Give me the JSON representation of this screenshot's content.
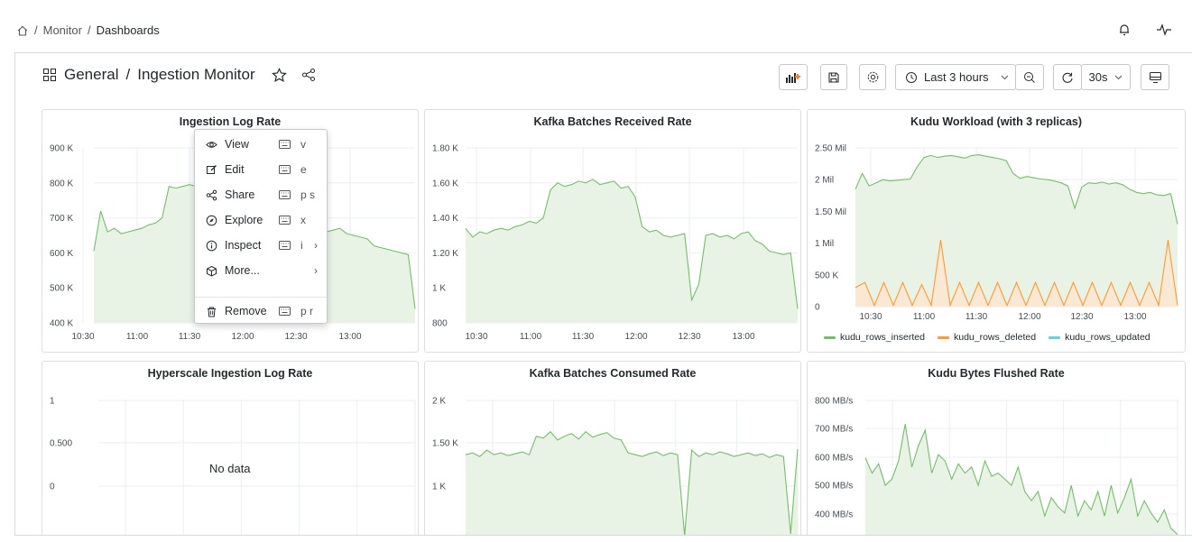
{
  "breadcrumb": {
    "items": [
      "Monitor",
      "Dashboards"
    ],
    "separator": "/"
  },
  "dashboard": {
    "folder": "General",
    "separator": "/",
    "title": "Ingestion Monitor"
  },
  "toolbar": {
    "time_range": "Last 3 hours",
    "refresh_interval": "30s"
  },
  "context_menu": {
    "items": [
      {
        "label": "View",
        "icon": "eye-icon",
        "shortcut": "v"
      },
      {
        "label": "Edit",
        "icon": "edit-icon",
        "shortcut": "e"
      },
      {
        "label": "Share",
        "icon": "share-icon",
        "shortcut": "p s"
      },
      {
        "label": "Explore",
        "icon": "compass-icon",
        "shortcut": "x"
      },
      {
        "label": "Inspect",
        "icon": "info-icon",
        "shortcut": "i",
        "submenu": true
      },
      {
        "label": "More...",
        "icon": "cube-icon",
        "submenu": true
      },
      {
        "label": "Remove",
        "icon": "trash-icon",
        "shortcut": "p r"
      }
    ]
  },
  "colors": {
    "green": "#73bf69",
    "green_fill": "#e8f3e6",
    "orange": "#ff9830",
    "orange_fill": "#fde5cf",
    "cyan": "#5ed7d6"
  },
  "panels": [
    {
      "title": "Ingestion Log Rate"
    },
    {
      "title": "Kafka Batches Received Rate"
    },
    {
      "title": "Kudu Workload (with 3 replicas)"
    },
    {
      "title": "Hyperscale Ingestion Log Rate",
      "no_data": "No data"
    },
    {
      "title": "Kafka Batches Consumed Rate"
    },
    {
      "title": "Kudu Bytes Flushed Rate"
    }
  ],
  "chart_data": [
    {
      "type": "area",
      "title": "Ingestion Log Rate",
      "y_ticks": [
        "900 K",
        "800 K",
        "700 K",
        "600 K",
        "500 K",
        "400 K"
      ],
      "x_ticks": [
        "10:30",
        "11:00",
        "11:30",
        "12:00",
        "12:30",
        "13:00"
      ],
      "ylim": [
        400000,
        900000
      ],
      "x_range": [
        "10:18",
        "13:18"
      ],
      "series": [
        {
          "values": [
            605000,
            720000,
            660000,
            670000,
            655000,
            660000,
            665000,
            670000,
            680000,
            685000,
            700000,
            790000,
            785000,
            790000,
            795000,
            790000,
            795000,
            790000,
            790000,
            785000,
            790000,
            780000,
            770000,
            760000,
            750000,
            740000,
            700000,
            690000,
            680000,
            675000,
            670000,
            660000,
            655000,
            650000,
            660000,
            665000,
            670000,
            655000,
            650000,
            645000,
            640000,
            620000,
            615000,
            610000,
            605000,
            600000,
            595000,
            440000
          ]
        }
      ]
    },
    {
      "type": "area",
      "title": "Kafka Batches Received Rate",
      "y_ticks": [
        "1.80 K",
        "1.60 K",
        "1.40 K",
        "1.20 K",
        "1 K",
        "800"
      ],
      "x_ticks": [
        "10:30",
        "11:00",
        "11:30",
        "12:00",
        "12:30",
        "13:00"
      ],
      "ylim": [
        800,
        1800
      ],
      "x_range": [
        "10:18",
        "13:18"
      ],
      "series": [
        {
          "values": [
            1340,
            1290,
            1320,
            1310,
            1330,
            1340,
            1330,
            1350,
            1360,
            1380,
            1370,
            1400,
            1560,
            1600,
            1580,
            1590,
            1610,
            1600,
            1620,
            1590,
            1600,
            1610,
            1570,
            1580,
            1520,
            1350,
            1320,
            1330,
            1300,
            1290,
            1300,
            1310,
            930,
            1020,
            1300,
            1310,
            1290,
            1300,
            1280,
            1310,
            1320,
            1270,
            1250,
            1210,
            1200,
            1190,
            1200,
            880
          ]
        }
      ]
    },
    {
      "type": "area",
      "title": "Kudu Workload (with 3 replicas)",
      "y_ticks": [
        "2.50 Mil",
        "2 Mil",
        "1.50 Mil",
        "1 Mil",
        "500 K",
        "0"
      ],
      "x_ticks": [
        "10:30",
        "11:00",
        "11:30",
        "12:00",
        "12:30",
        "13:00"
      ],
      "ylim": [
        0,
        2500000
      ],
      "x_range": [
        "10:22",
        "13:22"
      ],
      "legend": "bottom",
      "series": [
        {
          "name": "kudu_rows_inserted",
          "color": "#73bf69",
          "values": [
            1850000,
            2100000,
            1900000,
            1950000,
            2000000,
            1980000,
            1990000,
            2000000,
            2010000,
            2200000,
            2350000,
            2380000,
            2350000,
            2370000,
            2380000,
            2360000,
            2340000,
            2380000,
            2390000,
            2370000,
            2350000,
            2330000,
            2300000,
            2100000,
            2020000,
            2050000,
            2030000,
            2010000,
            2000000,
            1980000,
            1950000,
            1900000,
            1550000,
            1880000,
            1950000,
            1940000,
            1960000,
            1930000,
            1950000,
            1920000,
            1850000,
            1800000,
            1780000,
            1800000,
            1760000,
            1750000,
            1780000,
            1300000
          ]
        },
        {
          "name": "kudu_rows_deleted",
          "color": "#ff9830",
          "values": [
            300000,
            380000,
            20000,
            380000,
            20000,
            380000,
            20000,
            350000,
            20000,
            1050000,
            20000,
            380000,
            20000,
            380000,
            20000,
            380000,
            20000,
            380000,
            20000,
            380000,
            20000,
            380000,
            20000,
            380000,
            20000,
            380000,
            20000,
            380000,
            20000,
            380000,
            20000,
            380000,
            20000,
            1050000,
            20000
          ]
        },
        {
          "name": "kudu_rows_updated",
          "color": "#5ed7d6",
          "values": [
            0,
            0,
            0,
            0,
            0,
            0
          ]
        }
      ]
    },
    {
      "type": "line",
      "title": "Hyperscale Ingestion Log Rate",
      "y_ticks": [
        "1",
        "0.500",
        "0"
      ],
      "ylim": [
        0,
        1
      ],
      "series": []
    },
    {
      "type": "area",
      "title": "Kafka Batches Consumed Rate",
      "y_ticks": [
        "2 K",
        "1.50 K",
        "1 K"
      ],
      "ylim": [
        500,
        2000
      ],
      "series": [
        {
          "values": [
            1400,
            1420,
            1380,
            1450,
            1400,
            1420,
            1390,
            1410,
            1430,
            1400,
            1600,
            1580,
            1650,
            1560,
            1600,
            1630,
            1570,
            1650,
            1590,
            1620,
            1640,
            1580,
            1560,
            1420,
            1400,
            1380,
            1410,
            1430,
            1390,
            1420,
            1400,
            520,
            1450,
            1380,
            1420,
            1400,
            1430,
            1410,
            1380,
            1400,
            1420,
            1390,
            1410,
            1370,
            1400,
            1380,
            540,
            1460
          ]
        }
      ]
    },
    {
      "type": "area",
      "title": "Kudu Bytes Flushed Rate",
      "y_ticks": [
        "800 MB/s",
        "700 MB/s",
        "600 MB/s",
        "500 MB/s",
        "400 MB/s"
      ],
      "ylim": [
        350,
        800
      ],
      "series": [
        {
          "values": [
            610,
            560,
            590,
            520,
            540,
            600,
            720,
            580,
            650,
            700,
            560,
            620,
            600,
            540,
            590,
            560,
            580,
            520,
            600,
            550,
            560,
            540,
            520,
            580,
            500,
            470,
            500,
            420,
            480,
            450,
            430,
            520,
            420,
            470,
            440,
            500,
            420,
            520,
            430,
            480,
            540,
            420,
            470,
            430,
            400,
            440,
            380,
            360
          ]
        }
      ]
    }
  ]
}
